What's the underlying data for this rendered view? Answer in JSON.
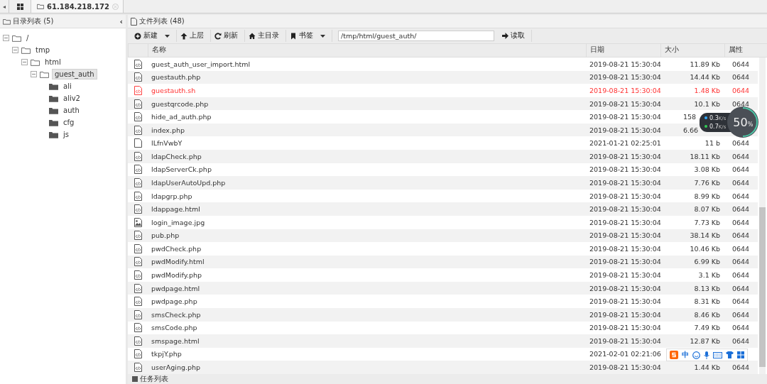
{
  "top_tabs": {
    "back": "◂",
    "tabs": [
      {
        "label": "61.184.218.172",
        "selected": true
      }
    ]
  },
  "dir_panel": {
    "title": "目录列表 (5)",
    "collapse": "‹",
    "tree": [
      {
        "label": "/",
        "expanded": true,
        "selected": false,
        "children": [
          {
            "label": "tmp",
            "expanded": true,
            "selected": false,
            "children": [
              {
                "label": "html",
                "expanded": true,
                "selected": false,
                "children": [
                  {
                    "label": "guest_auth",
                    "expanded": true,
                    "selected": true,
                    "children": [
                      {
                        "label": "ali",
                        "expanded": false,
                        "selected": false
                      },
                      {
                        "label": "aliv2",
                        "expanded": false,
                        "selected": false
                      },
                      {
                        "label": "auth",
                        "expanded": false,
                        "selected": false
                      },
                      {
                        "label": "cfg",
                        "expanded": false,
                        "selected": false
                      },
                      {
                        "label": "js",
                        "expanded": false,
                        "selected": false
                      }
                    ]
                  }
                ]
              }
            ]
          }
        ]
      }
    ]
  },
  "file_panel": {
    "title": "文件列表 (48)",
    "toolbar": [
      {
        "label": "新建",
        "dropdown": true
      },
      {
        "label": "上层",
        "dropdown": false
      },
      {
        "label": "刷新",
        "dropdown": false
      },
      {
        "label": "主目录",
        "dropdown": false
      },
      {
        "label": "书签",
        "dropdown": true
      }
    ],
    "path": "/tmp/html/guest_auth/",
    "go": "读取",
    "table": {
      "columns": [
        "名称",
        "日期",
        "大小",
        "属性"
      ],
      "rows": [
        {
          "kind": "code",
          "highlight": false,
          "name": "guest_auth_user_import.html",
          "date": "2019-08-21 15:30:04",
          "size": "11.89 Kb",
          "perm": "0644"
        },
        {
          "kind": "code",
          "highlight": false,
          "name": "guestauth.php",
          "date": "2019-08-21 15:30:04",
          "size": "14.44 Kb",
          "perm": "0644"
        },
        {
          "kind": "code",
          "highlight": true,
          "name": "guestauth.sh",
          "date": "2019-08-21 15:30:04",
          "size": "1.48 Kb",
          "perm": "0644"
        },
        {
          "kind": "code",
          "highlight": false,
          "name": "guestqrcode.php",
          "date": "2019-08-21 15:30:04",
          "size": "10.1 Kb",
          "perm": "0644"
        },
        {
          "kind": "code",
          "highlight": false,
          "name": "hide_ad_auth.php",
          "date": "2019-08-21 15:30:04",
          "size": "158"
        },
        {
          "kind": "code",
          "highlight": false,
          "name": "index.php",
          "date": "2019-08-21 15:30:04",
          "size": "6.66"
        },
        {
          "kind": "text",
          "highlight": false,
          "name": "lLfnVwbY",
          "date": "2021-01-21 02:25:01",
          "size": "11 b",
          "perm": "0644"
        },
        {
          "kind": "code",
          "highlight": false,
          "name": "ldapCheck.php",
          "date": "2019-08-21 15:30:04",
          "size": "18.11 Kb",
          "perm": "0644"
        },
        {
          "kind": "code",
          "highlight": false,
          "name": "ldapServerCk.php",
          "date": "2019-08-21 15:30:04",
          "size": "3.08 Kb",
          "perm": "0644"
        },
        {
          "kind": "code",
          "highlight": false,
          "name": "ldapUserAutoUpd.php",
          "date": "2019-08-21 15:30:04",
          "size": "7.76 Kb",
          "perm": "0644"
        },
        {
          "kind": "code",
          "highlight": false,
          "name": "ldapgrp.php",
          "date": "2019-08-21 15:30:04",
          "size": "8.99 Kb",
          "perm": "0644"
        },
        {
          "kind": "code",
          "highlight": false,
          "name": "ldappage.html",
          "date": "2019-08-21 15:30:04",
          "size": "8.07 Kb",
          "perm": "0644"
        },
        {
          "kind": "image",
          "highlight": false,
          "name": "login_image.jpg",
          "date": "2019-08-21 15:30:04",
          "size": "7.73 Kb",
          "perm": "0644"
        },
        {
          "kind": "code",
          "highlight": false,
          "name": "pub.php",
          "date": "2019-08-21 15:30:04",
          "size": "38.14 Kb",
          "perm": "0644"
        },
        {
          "kind": "code",
          "highlight": false,
          "name": "pwdCheck.php",
          "date": "2019-08-21 15:30:04",
          "size": "10.46 Kb",
          "perm": "0644"
        },
        {
          "kind": "code",
          "highlight": false,
          "name": "pwdModify.html",
          "date": "2019-08-21 15:30:04",
          "size": "6.99 Kb",
          "perm": "0644"
        },
        {
          "kind": "code",
          "highlight": false,
          "name": "pwdModify.php",
          "date": "2019-08-21 15:30:04",
          "size": "3.1 Kb",
          "perm": "0644"
        },
        {
          "kind": "code",
          "highlight": false,
          "name": "pwdpage.html",
          "date": "2019-08-21 15:30:04",
          "size": "8.13 Kb",
          "perm": "0644"
        },
        {
          "kind": "code",
          "highlight": false,
          "name": "pwdpage.php",
          "date": "2019-08-21 15:30:04",
          "size": "8.31 Kb",
          "perm": "0644"
        },
        {
          "kind": "code",
          "highlight": false,
          "name": "smsCheck.php",
          "date": "2019-08-21 15:30:04",
          "size": "8.46 Kb",
          "perm": "0644"
        },
        {
          "kind": "code",
          "highlight": false,
          "name": "smsCode.php",
          "date": "2019-08-21 15:30:04",
          "size": "7.49 Kb",
          "perm": "0644"
        },
        {
          "kind": "code",
          "highlight": false,
          "name": "smspage.html",
          "date": "2019-08-21 15:30:04",
          "size": "12.87 Kb",
          "perm": "0644"
        },
        {
          "kind": "code",
          "highlight": false,
          "name": "tkpjY.php",
          "date": "2021-02-01 02:21:06"
        },
        {
          "kind": "code",
          "highlight": false,
          "name": "userAging.php",
          "date": "2019-08-21 15:30:04",
          "size": "1.44 Kb",
          "perm": "0644"
        }
      ]
    }
  },
  "task_panel": {
    "title": "任务列表"
  },
  "speed_widget": {
    "up": "0.3",
    "up_unit": "K/s",
    "down": "0.7",
    "down_unit": "K/s",
    "percent": "50",
    "percent_unit": "%",
    "level": 0.5
  },
  "ime_bar": {
    "mode": "中"
  }
}
